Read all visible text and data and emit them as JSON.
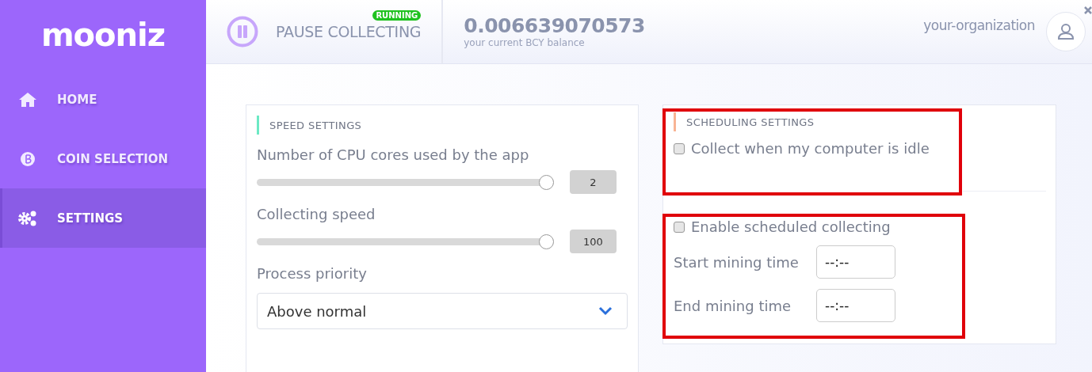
{
  "logo": "mooniz",
  "sidebar": {
    "items": [
      {
        "label": "HOME",
        "kind": "home",
        "selected": false
      },
      {
        "label": "COIN SELECTION",
        "kind": "coin",
        "selected": false
      },
      {
        "label": "SETTINGS",
        "kind": "gears",
        "selected": true
      }
    ]
  },
  "header": {
    "pause_button": {
      "label": "PAUSE COLLECTING",
      "status": "RUNNING"
    },
    "balance": {
      "value": "0.006639070573",
      "caption": "your current BCY balance"
    },
    "organization": "your-organization"
  },
  "speed_settings": {
    "title": "SPEED SETTINGS",
    "sliders": [
      {
        "label": "Number of CPU cores used by the app",
        "level": 1.0,
        "value": "2"
      },
      {
        "label": "Collecting speed",
        "level": 1.0,
        "value": "100"
      }
    ],
    "priority": {
      "label": "Process priority",
      "value": "Above normal"
    }
  },
  "scheduling_settings": {
    "title": "SCHEDULING SETTINGS",
    "highlighted": true,
    "idle": {
      "label": "Collect when my computer is idle",
      "checked": false
    },
    "schedule": {
      "highlighted": true,
      "enable": {
        "label": "Enable scheduled collecting",
        "checked": false
      },
      "times": [
        {
          "label": "Start mining time",
          "value": "--:--"
        },
        {
          "label": "End mining time",
          "value": "--:--"
        }
      ]
    }
  }
}
